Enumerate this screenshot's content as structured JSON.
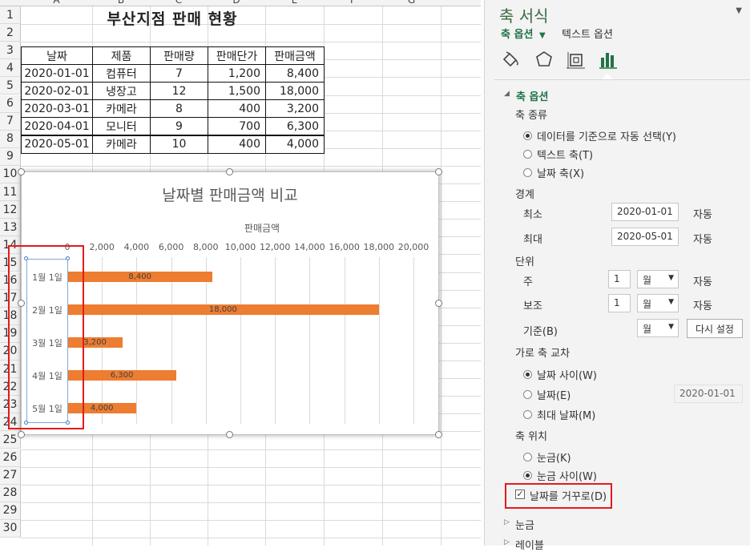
{
  "sheet": {
    "columns": [
      "A",
      "B",
      "C",
      "D",
      "E",
      "F",
      "G"
    ],
    "rows": [
      "1",
      "2",
      "3",
      "4",
      "5",
      "6",
      "7",
      "8",
      "9",
      "10",
      "11",
      "12",
      "13",
      "14",
      "15",
      "16",
      "17",
      "18",
      "19",
      "20",
      "21",
      "22",
      "23",
      "24",
      "25",
      "26",
      "27",
      "28",
      "29",
      "30"
    ],
    "title": "부산지점 판매 현황",
    "headers": [
      "날짜",
      "제품",
      "판매량",
      "판매단가",
      "판매금액"
    ],
    "data_rows": [
      [
        "2020-01-01",
        "컴퓨터",
        "7",
        "1,200",
        "8,400"
      ],
      [
        "2020-02-01",
        "냉장고",
        "12",
        "1,500",
        "18,000"
      ],
      [
        "2020-03-01",
        "카메라",
        "8",
        "400",
        "3,200"
      ],
      [
        "2020-04-01",
        "모니터",
        "9",
        "700",
        "6,300"
      ],
      [
        "2020-05-01",
        "카메라",
        "10",
        "400",
        "4,000"
      ]
    ]
  },
  "chart_data": {
    "type": "bar",
    "orientation": "horizontal",
    "title": "날짜별 판매금액 비교",
    "value_axis_title": "판매금액",
    "value_axis_position": "top",
    "categories": [
      "1월 1일",
      "2월 1일",
      "3월 1일",
      "4월 1일",
      "5월 1일"
    ],
    "series": [
      {
        "name": "판매금액",
        "values": [
          8400,
          18000,
          3200,
          6300,
          4000
        ],
        "labels": [
          "8,400",
          "18,000",
          "3,200",
          "6,300",
          "4,000"
        ]
      }
    ],
    "xlim": [
      0,
      20000
    ],
    "tick_labels": [
      "0",
      "2,000",
      "4,000",
      "6,000",
      "8,000",
      "10,000",
      "12,000",
      "14,000",
      "16,000",
      "18,000",
      "20,000"
    ],
    "grid": true,
    "bar_color": "#ed7d31"
  },
  "pane": {
    "title": "축 서식",
    "close": "▼",
    "tabs": {
      "axis_options": "축 옵션",
      "text_options": "텍스트 옵션"
    },
    "icons": [
      "fill-line-icon",
      "effects-icon",
      "size-properties-icon",
      "axis-options-icon"
    ],
    "section_axis_options": "축 옵션",
    "axis_type": {
      "label": "축 종류",
      "options": [
        "데이터를 기준으로 자동 선택(Y)",
        "텍스트 축(T)",
        "날짜 축(X)"
      ],
      "selected": 0
    },
    "bounds": {
      "label": "경계",
      "min_label": "최소",
      "min_value": "2020-01-01",
      "min_auto": "자동",
      "max_label": "최대",
      "max_value": "2020-05-01",
      "max_auto": "자동"
    },
    "units": {
      "label": "단위",
      "major_label": "주",
      "major_value": "1",
      "major_unit": "월",
      "major_auto": "자동",
      "minor_label": "보조",
      "minor_value": "1",
      "minor_unit": "월",
      "minor_auto": "자동",
      "base_label": "기준(B)",
      "base_unit": "월",
      "reset": "다시 설정"
    },
    "crosses": {
      "label": "가로 축 교차",
      "options": [
        "날짜 사이(W)",
        "날짜(E)",
        "최대 날짜(M)"
      ],
      "selected": 0,
      "date_value": "2020-01-01"
    },
    "axis_position": {
      "label": "축 위치",
      "options": [
        "눈금(K)",
        "눈금 사이(W)"
      ],
      "selected": 1
    },
    "reverse": {
      "label": "날짜를 거꾸로(D)",
      "checked": true,
      "check_mark": "✓"
    },
    "collapsed": [
      "눈금",
      "레이블"
    ],
    "highlight_color": "#e21b1b",
    "accent_color": "#217346"
  }
}
